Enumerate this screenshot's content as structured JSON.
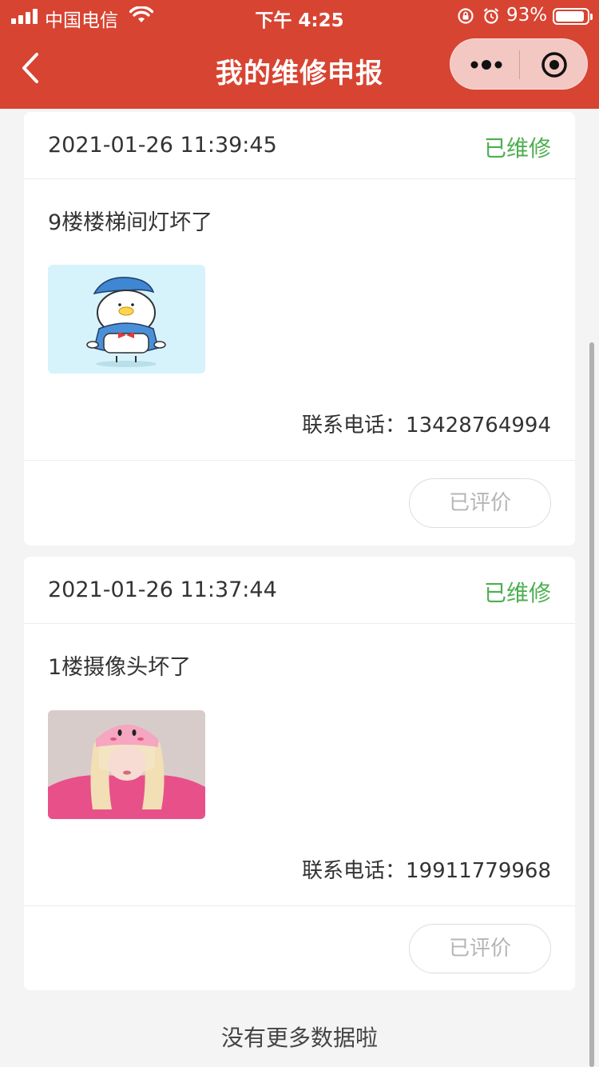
{
  "status_bar": {
    "carrier": "中国电信",
    "time": "下午 4:25",
    "battery": "93%"
  },
  "nav": {
    "title": "我的维修申报"
  },
  "records": [
    {
      "datetime": "2021-01-26 11:39:45",
      "status": "已维修",
      "description": "9楼楼梯间灯坏了",
      "image": "duck-cartoon-image",
      "phone_label": "联系电话：",
      "phone": "13428764994",
      "action": "已评价"
    },
    {
      "datetime": "2021-01-26 11:37:44",
      "status": "已维修",
      "description": "1楼摄像头坏了",
      "image": "girl-pink-hat-photo",
      "phone_label": "联系电话：",
      "phone": "19911779968",
      "action": "已评价"
    }
  ],
  "footer": {
    "no_more": "没有更多数据啦"
  },
  "colors": {
    "header": "#d84432",
    "status_done": "#4caf50",
    "background": "#f4f4f4"
  }
}
